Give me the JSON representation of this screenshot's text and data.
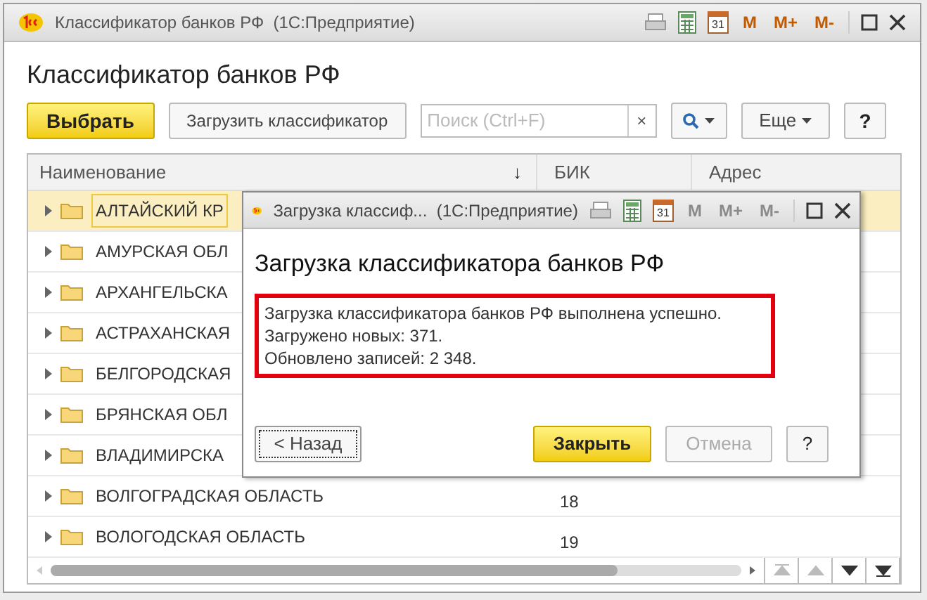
{
  "window": {
    "title": "Классификатор банков РФ  (1С:Предприятие)",
    "calendar_day": "31",
    "memory_buttons": [
      "M",
      "M+",
      "M-"
    ],
    "memory_disabled": false
  },
  "heading": "Классификатор банков РФ",
  "toolbar": {
    "select_button": "Выбрать",
    "load_button": "Загрузить классификатор",
    "search": {
      "placeholder": "Поиск (Ctrl+F)",
      "clear": "×"
    },
    "more_button": "Еще",
    "help_button": "?"
  },
  "table": {
    "columns": [
      {
        "label": "Наименование",
        "sort": "↓"
      },
      {
        "label": "БИК"
      },
      {
        "label": "Адрес"
      }
    ],
    "rows": [
      {
        "name": "АЛТАЙСКИЙ КР",
        "bik": "",
        "selected": true
      },
      {
        "name": "АМУРСКАЯ ОБЛ",
        "bik": "",
        "selected": false
      },
      {
        "name": "АРХАНГЕЛЬСКА",
        "bik": "",
        "selected": false
      },
      {
        "name": "АСТРАХАНСКАЯ",
        "bik": "",
        "selected": false
      },
      {
        "name": "БЕЛГОРОДСКАЯ",
        "bik": "",
        "selected": false
      },
      {
        "name": "БРЯНСКАЯ ОБЛ",
        "bik": "",
        "selected": false
      },
      {
        "name": "ВЛАДИМИРСКА",
        "bik": "",
        "selected": false
      },
      {
        "name": "ВОЛГОГРАДСКАЯ ОБЛАСТЬ",
        "bik": "18",
        "selected": false
      },
      {
        "name": "ВОЛОГОДСКАЯ ОБЛАСТЬ",
        "bik": "19",
        "selected": false
      }
    ]
  },
  "dialog": {
    "title": "Загрузка классиф...  (1С:Предприятие)",
    "calendar_day": "31",
    "memory_buttons": [
      "M",
      "M+",
      "M-"
    ],
    "memory_disabled": true,
    "heading": "Загрузка классификатора банков РФ",
    "message": [
      "Загрузка классификатора банков РФ выполнена успешно.",
      "Загружено новых: 371.",
      "Обновлено записей: 2 348."
    ],
    "buttons": [
      {
        "kind": "back",
        "label": "< Назад",
        "disabled": false
      },
      {
        "kind": "primary",
        "label": "Закрыть",
        "disabled": false
      },
      {
        "kind": "normal",
        "label": "Отмена",
        "disabled": true
      },
      {
        "kind": "help",
        "label": "?",
        "disabled": false
      }
    ]
  }
}
